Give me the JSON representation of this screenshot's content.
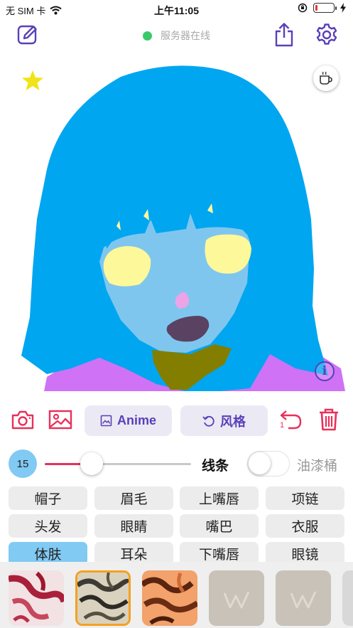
{
  "status_bar": {
    "carrier": "无 SIM 卡",
    "time": "上午11:05"
  },
  "toolbar": {
    "server_status": "服务器在线"
  },
  "actions": {
    "anime_label": "Anime",
    "style_label": "风格",
    "undo_count": "1"
  },
  "brush": {
    "size": "15",
    "size_fraction": 0.32,
    "mode_label": "线条",
    "fill_label": "油漆桶",
    "fill_enabled": false
  },
  "parts": [
    {
      "label": "帽子"
    },
    {
      "label": "眉毛"
    },
    {
      "label": "上嘴唇"
    },
    {
      "label": "项链"
    },
    {
      "label": "头发"
    },
    {
      "label": "眼睛"
    },
    {
      "label": "嘴巴"
    },
    {
      "label": "衣服"
    },
    {
      "label": "体肤"
    },
    {
      "label": "耳朵"
    },
    {
      "label": "下嘴唇"
    },
    {
      "label": "眼镜"
    }
  ],
  "selected_part": "体肤",
  "colors": {
    "accent": "#5a40b8",
    "danger": "#e8305a",
    "selected_part_bg": "#80caf3",
    "hair": "#00a6f0",
    "skin": "#7fc6ef",
    "eyes": "#fdf89a",
    "clothes": "#cf72f5",
    "neck": "#837e00",
    "mouth": "#5a4263",
    "nose": "#eca4e6"
  }
}
